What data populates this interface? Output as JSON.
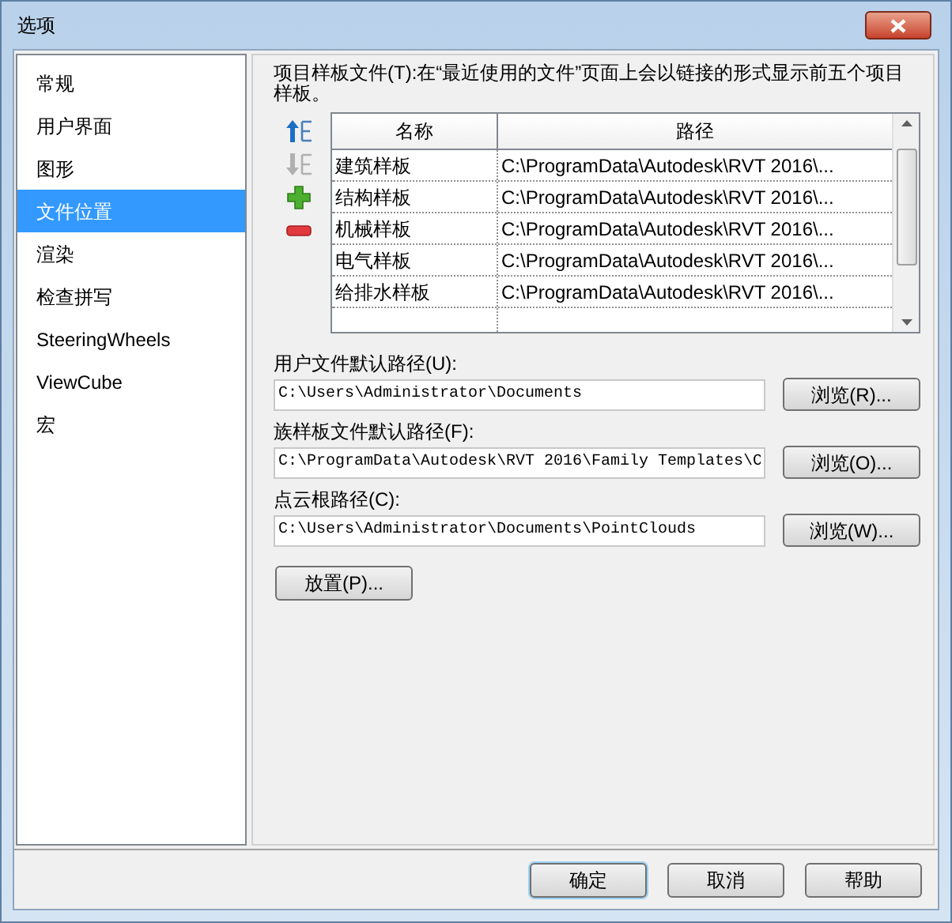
{
  "window": {
    "title": "选项"
  },
  "sidebar": {
    "items": [
      {
        "label": "常规",
        "selected": false
      },
      {
        "label": "用户界面",
        "selected": false
      },
      {
        "label": "图形",
        "selected": false
      },
      {
        "label": "文件位置",
        "selected": true
      },
      {
        "label": "渲染",
        "selected": false
      },
      {
        "label": "检查拼写",
        "selected": false
      },
      {
        "label": "SteeringWheels",
        "selected": false
      },
      {
        "label": "ViewCube",
        "selected": false
      },
      {
        "label": "宏",
        "selected": false
      }
    ]
  },
  "description": "项目样板文件(T):在“最近使用的文件”页面上会以链接的形式显示前五个项目样板。",
  "tool_buttons": [
    {
      "kind": "move_up",
      "disabled": false
    },
    {
      "kind": "move_down",
      "disabled": true
    },
    {
      "kind": "add",
      "disabled": false
    },
    {
      "kind": "remove",
      "disabled": false
    }
  ],
  "table": {
    "columns": [
      "名称",
      "路径"
    ],
    "rows": [
      [
        "建筑样板",
        "C:\\ProgramData\\Autodesk\\RVT 2016\\..."
      ],
      [
        "结构样板",
        "C:\\ProgramData\\Autodesk\\RVT 2016\\..."
      ],
      [
        "机械样板",
        "C:\\ProgramData\\Autodesk\\RVT 2016\\..."
      ],
      [
        "电气样板",
        "C:\\ProgramData\\Autodesk\\RVT 2016\\..."
      ],
      [
        "给排水样板",
        "C:\\ProgramData\\Autodesk\\RVT 2016\\..."
      ]
    ]
  },
  "paths": [
    {
      "label": "用户文件默认路径(U):",
      "value": "C:\\Users\\Administrator\\Documents",
      "button": "浏览(R)..."
    },
    {
      "label": "族样板文件默认路径(F):",
      "value": "C:\\ProgramData\\Autodesk\\RVT 2016\\Family Templates\\C",
      "button": "浏览(O)..."
    },
    {
      "label": "点云根路径(C):",
      "value": "C:\\Users\\Administrator\\Documents\\PointClouds",
      "button": "浏览(W)..."
    }
  ],
  "place_button": "放置(P)...",
  "footer_buttons": [
    {
      "label": "确定",
      "default": true
    },
    {
      "label": "取消",
      "default": false
    },
    {
      "label": "帮助",
      "default": false
    }
  ]
}
